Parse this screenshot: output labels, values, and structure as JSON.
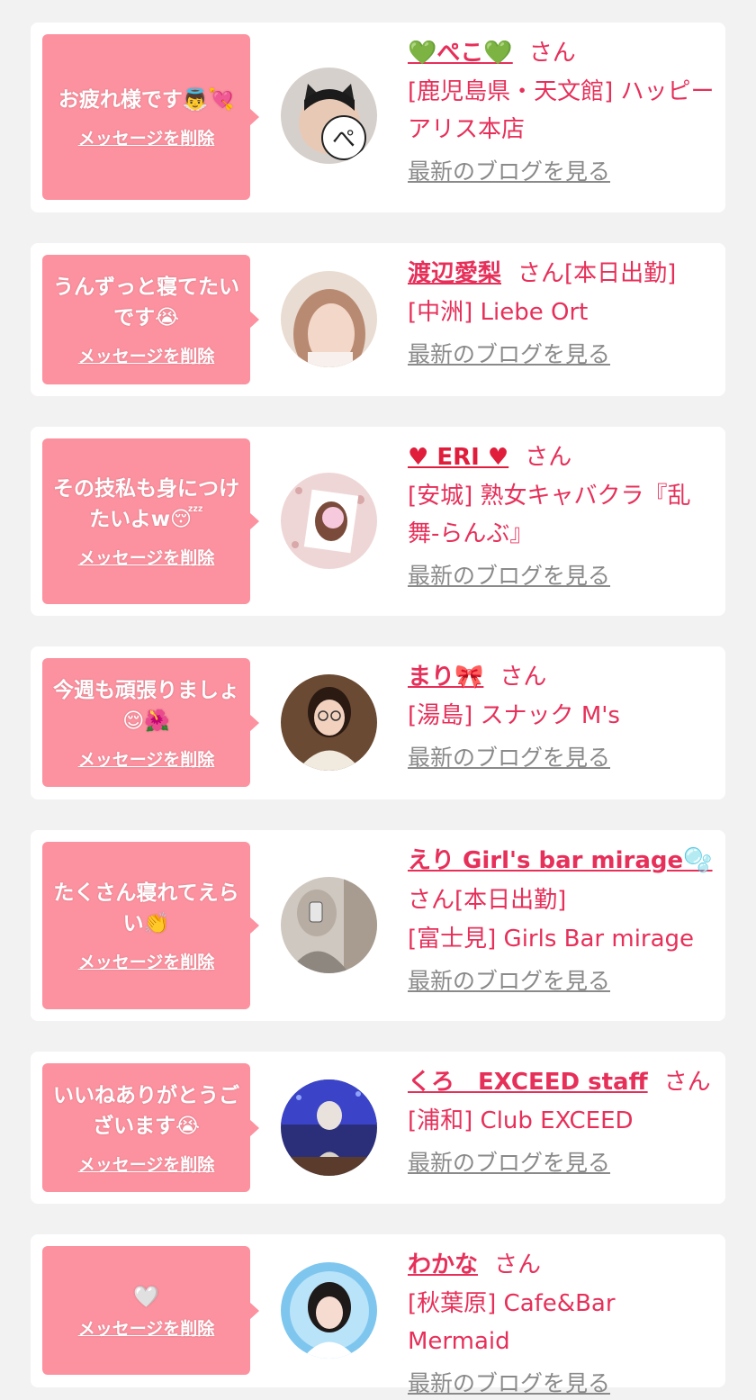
{
  "common": {
    "delete_label": "メッセージを削除",
    "blog_label": "最新のブログを見る",
    "san_label": "さん"
  },
  "colors": {
    "page_bg": "#f2f2f2",
    "card_bg": "#ffffff",
    "bubble_bg": "#fc919f",
    "name_color": "#e6305a",
    "blog_link_color": "#8a8a8a"
  },
  "cards": [
    {
      "message": "お疲れ様です👼💘",
      "name": "💚ぺこ💚",
      "suffix": "",
      "shop": "[鹿児島県・天文館] ハッピーアリス本店",
      "avatar_icon": "cat-ear-avatar-icon"
    },
    {
      "message": "うんずっと寝てたいです😭",
      "name": "渡辺愛梨",
      "suffix": "[本日出勤]",
      "shop": "[中洲] Liebe Ort",
      "avatar_icon": "woman-photo-avatar-icon"
    },
    {
      "message": "その技私も身につけたいよw😴",
      "name": "♥ ERI ♥",
      "suffix": "",
      "shop": "[安城] 熟女キャバクラ『乱舞-らんぶ』",
      "avatar_icon": "woman-photo-avatar-icon"
    },
    {
      "message": "今週も頑張りましょ😌🌺",
      "name": "まり🎀",
      "suffix": "",
      "shop": "[湯島] スナック M's",
      "avatar_icon": "woman-glasses-avatar-icon"
    },
    {
      "message": "たくさん寝れてえらい👏",
      "name": "えり Girl's bar mirage🫧",
      "suffix": "[本日出勤]",
      "shop": "[富士見] Girls Bar mirage",
      "avatar_icon": "mirror-selfie-avatar-icon"
    },
    {
      "message": "いいねありがとうございます😭",
      "name": "くろ　EXCEED staff",
      "suffix": "",
      "shop": "[浦和] Club EXCEED",
      "avatar_icon": "aquarium-photo-avatar-icon"
    },
    {
      "message": "🤍",
      "name": "わかな",
      "suffix": "",
      "shop": "[秋葉原] Cafe&Bar Mermaid",
      "avatar_icon": "blue-background-avatar-icon"
    }
  ]
}
